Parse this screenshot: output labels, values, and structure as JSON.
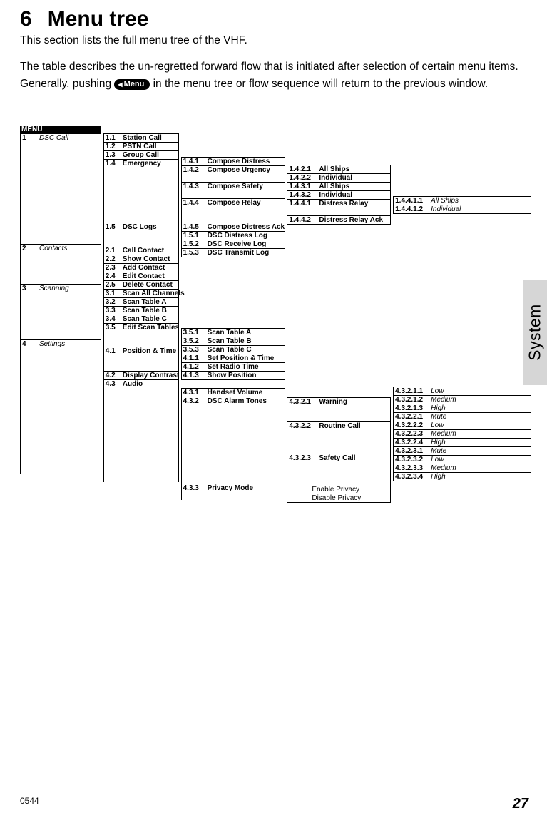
{
  "header": {
    "num": "6",
    "title": "Menu tree"
  },
  "intro": "This section lists the full menu tree of the VHF.",
  "desc1": "The table describes the un-regretted forward flow that is initiated after selection of certain menu items. Generally, pushing ",
  "menuButton": "Menu",
  "desc2": " in the menu tree or flow sequence will return to the previous window.",
  "sideTab": "System",
  "footerCode": "0544",
  "pageNum": "27",
  "tree": {
    "menu": "MENU",
    "l1": [
      {
        "n": "1",
        "t": "DSC Call"
      },
      {
        "n": "2",
        "t": "Contacts"
      },
      {
        "n": "3",
        "t": "Scanning"
      },
      {
        "n": "4",
        "t": "Settings"
      }
    ],
    "l2_1": [
      {
        "n": "1.1",
        "t": "Station Call"
      },
      {
        "n": "1.2",
        "t": "PSTN Call"
      },
      {
        "n": "1.3",
        "t": "Group Call"
      },
      {
        "n": "1.4",
        "t": "Emergency"
      },
      {
        "n": "1.5",
        "t": "DSC Logs"
      }
    ],
    "l2_2": [
      {
        "n": "2.1",
        "t": "Call Contact"
      },
      {
        "n": "2.2",
        "t": "Show Contact"
      },
      {
        "n": "2.3",
        "t": "Add Contact"
      },
      {
        "n": "2.4",
        "t": "Edit Contact"
      },
      {
        "n": "2.5",
        "t": "Delete Contact"
      }
    ],
    "l2_3": [
      {
        "n": "3.1",
        "t": "Scan All Channels"
      },
      {
        "n": "3.2",
        "t": "Scan Table A"
      },
      {
        "n": "3.3",
        "t": "Scan Table B"
      },
      {
        "n": "3.4",
        "t": "Scan Table C"
      },
      {
        "n": "3.5",
        "t": "Edit Scan Tables"
      }
    ],
    "l2_4": [
      {
        "n": "4.1",
        "t": "Position & Time"
      },
      {
        "n": "4.2",
        "t": "Display Contrast"
      },
      {
        "n": "4.3",
        "t": "Audio"
      }
    ],
    "l3_14": [
      {
        "n": "1.4.1",
        "t": "Compose Distress"
      },
      {
        "n": "1.4.2",
        "t": "Compose Urgency"
      },
      {
        "n": "1.4.3",
        "t": "Compose Safety"
      },
      {
        "n": "1.4.4",
        "t": "Compose Relay"
      },
      {
        "n": "1.4.5",
        "t": "Compose Distress Ack"
      }
    ],
    "l3_15": [
      {
        "n": "1.5.1",
        "t": "DSC Distress Log"
      },
      {
        "n": "1.5.2",
        "t": "DSC Receive Log"
      },
      {
        "n": "1.5.3",
        "t": "DSC Transmit Log"
      }
    ],
    "l3_35": [
      {
        "n": "3.5.1",
        "t": "Scan Table A"
      },
      {
        "n": "3.5.2",
        "t": "Scan Table B"
      },
      {
        "n": "3.5.3",
        "t": "Scan Table C"
      }
    ],
    "l3_41": [
      {
        "n": "4.1.1",
        "t": "Set Position & Time"
      },
      {
        "n": "4.1.2",
        "t": "Set Radio Time"
      },
      {
        "n": "4.1.3",
        "t": "Show Position"
      }
    ],
    "l3_43": [
      {
        "n": "4.3.1",
        "t": "Handset Volume"
      },
      {
        "n": "4.3.2",
        "t": "DSC Alarm Tones"
      },
      {
        "n": "4.3.3",
        "t": "Privacy Mode"
      }
    ],
    "l4_142": [
      {
        "n": "1.4.2.1",
        "t": "All Ships"
      },
      {
        "n": "1.4.2.2",
        "t": "Individual"
      }
    ],
    "l4_143": [
      {
        "n": "1.4.3.1",
        "t": "All Ships"
      },
      {
        "n": "1.4.3.2",
        "t": "Individual"
      }
    ],
    "l4_144": [
      {
        "n": "1.4.4.1",
        "t": "Distress Relay"
      },
      {
        "n": "1.4.4.2",
        "t": "Distress Relay Ack"
      }
    ],
    "l4_432": [
      {
        "n": "4.3.2.1",
        "t": "Warning"
      },
      {
        "n": "4.3.2.2",
        "t": "Routine Call"
      },
      {
        "n": "4.3.2.3",
        "t": "Safety Call"
      }
    ],
    "l4_433": [
      {
        "t": "Enable Privacy"
      },
      {
        "t": "Disable Privacy"
      }
    ],
    "l5_1441": [
      {
        "n": "1.4.4.1.1",
        "t": "All Ships"
      },
      {
        "n": "1.4.4.1.2",
        "t": "Individual"
      }
    ],
    "l5_4321": [
      {
        "n": "4.3.2.1.1",
        "t": "Low"
      },
      {
        "n": "4.3.2.1.2",
        "t": "Medium"
      },
      {
        "n": "4.3.2.1.3",
        "t": "High"
      }
    ],
    "l5_4322": [
      {
        "n": "4.3.2.2.1",
        "t": "Mute"
      },
      {
        "n": "4.3.2.2.2",
        "t": "Low"
      },
      {
        "n": "4.3.2.2.3",
        "t": "Medium"
      },
      {
        "n": "4.3.2.2.4",
        "t": "High"
      }
    ],
    "l5_4323": [
      {
        "n": "4.3.2.3.1",
        "t": "Mute"
      },
      {
        "n": "4.3.2.3.2",
        "t": "Low"
      },
      {
        "n": "4.3.2.3.3",
        "t": "Medium"
      },
      {
        "n": "4.3.2.3.4",
        "t": "High"
      }
    ]
  }
}
